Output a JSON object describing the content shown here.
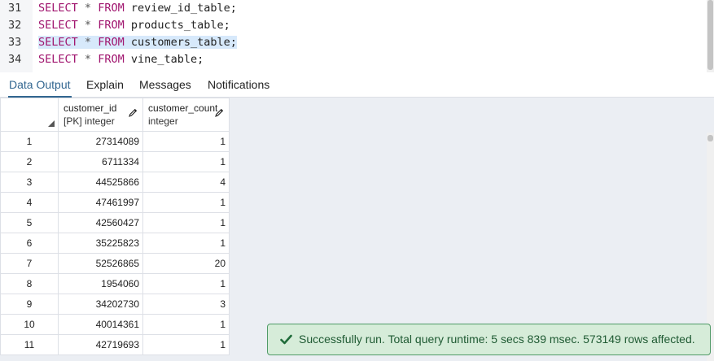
{
  "editor": {
    "lines": [
      {
        "number": "31",
        "keyword1": "SELECT",
        "operator": "*",
        "keyword2": "FROM",
        "table": "review_id_table;"
      },
      {
        "number": "32",
        "keyword1": "SELECT",
        "operator": "*",
        "keyword2": "FROM",
        "table": "products_table;"
      },
      {
        "number": "33",
        "keyword1": "SELECT",
        "operator": "*",
        "keyword2": "FROM",
        "table": "customers_table;",
        "highlighted": true
      },
      {
        "number": "34",
        "keyword1": "SELECT",
        "operator": "*",
        "keyword2": "FROM",
        "table": "vine_table;"
      }
    ]
  },
  "tabs": [
    {
      "label": "Data Output",
      "active": true
    },
    {
      "label": "Explain"
    },
    {
      "label": "Messages"
    },
    {
      "label": "Notifications"
    }
  ],
  "grid": {
    "columns": [
      {
        "name": "customer_id",
        "type": "[PK] integer",
        "icon": "pencil-icon"
      },
      {
        "name": "customer_count",
        "type": "integer",
        "icon": "pencil-icon"
      }
    ],
    "rows": [
      {
        "n": "1",
        "customer_id": "27314089",
        "customer_count": "1"
      },
      {
        "n": "2",
        "customer_id": "6711334",
        "customer_count": "1"
      },
      {
        "n": "3",
        "customer_id": "44525866",
        "customer_count": "4"
      },
      {
        "n": "4",
        "customer_id": "47461997",
        "customer_count": "1"
      },
      {
        "n": "5",
        "customer_id": "42560427",
        "customer_count": "1"
      },
      {
        "n": "6",
        "customer_id": "35225823",
        "customer_count": "1"
      },
      {
        "n": "7",
        "customer_id": "52526865",
        "customer_count": "20"
      },
      {
        "n": "8",
        "customer_id": "1954060",
        "customer_count": "1"
      },
      {
        "n": "9",
        "customer_id": "34202730",
        "customer_count": "3"
      },
      {
        "n": "10",
        "customer_id": "40014361",
        "customer_count": "1"
      },
      {
        "n": "11",
        "customer_id": "42719693",
        "customer_count": "1"
      }
    ]
  },
  "toast": {
    "icon": "check-icon",
    "message": "Successfully run. Total query runtime: 5 secs 839 msec. 573149 rows affected."
  },
  "colors": {
    "keyword": "#a0146e",
    "active_tab": "#326690",
    "toast_bg": "#d6ecd9",
    "toast_border": "#4f9a66",
    "line_highlight": "#d7e9fb"
  }
}
